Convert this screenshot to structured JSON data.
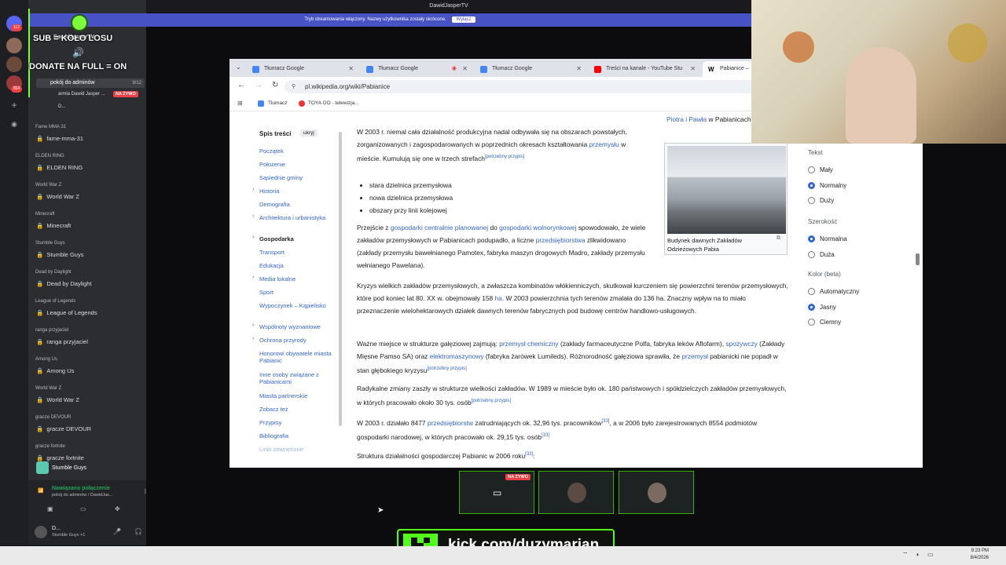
{
  "window": {
    "title": "DawidJasperTV",
    "streaming_notice": "Tryb streamowania włączony. Nazwy użytkownika zostały skrócone.",
    "streaming_off_button": "Wyłącz"
  },
  "overlay": {
    "line1": "SUB = KOŁO LOSU",
    "line2": "DONATE NA FULL = ON",
    "kick_url": "kick.com/duzymarian"
  },
  "discord": {
    "server_name": "DawidJasperTV",
    "badges": [
      "112",
      "864"
    ],
    "live_channel": "pokój do adminów",
    "live_count": "9/12",
    "voice_user1": "armia Dawid Jasper ...",
    "live_badge": "NA ŻYWO",
    "voice_user2": "D...",
    "categories": [
      {
        "cat": "Fame MMA 31",
        "ch": "fame-mma-31"
      },
      {
        "cat": "ELDEN RING",
        "ch": "ELDEN RING"
      },
      {
        "cat": "World War Z",
        "ch": "World War Z"
      },
      {
        "cat": "Minecraft",
        "ch": "Minecraft"
      },
      {
        "cat": "Stumble Guys",
        "ch": "Stumble Guys"
      },
      {
        "cat": "Dead by Daylight",
        "ch": "Dead by Daylight"
      },
      {
        "cat": "League of Legends",
        "ch": "League of Legends"
      },
      {
        "cat": "ranga przyjaciel",
        "ch": "ranga przyjaciel"
      },
      {
        "cat": "Among Us",
        "ch": "Among Us"
      },
      {
        "cat": "World War Z",
        "ch": "World War Z"
      },
      {
        "cat": "gracze DEVOUR",
        "ch": "gracze DEVOUR"
      },
      {
        "cat": "gracze fortnite",
        "ch": "gracze fortnite"
      }
    ],
    "activity": "Stumble Guys",
    "connection_status": "Nawiązano połączenie",
    "connection_channel": "pokój do adminów / DawidJas...",
    "user_name": "D...",
    "user_status": "Stumble Guys +1"
  },
  "browser": {
    "tabs": [
      {
        "label": "Tłumacz Google"
      },
      {
        "label": "Tłumacz Google"
      },
      {
        "label": "Tłumacz Google"
      },
      {
        "label": "Treści na kanale - YouTube Stu"
      },
      {
        "label": "Pabianice –"
      }
    ],
    "url": "pl.wikipedia.org/wiki/Pabianice",
    "bookmarks": [
      "Tłumacz",
      "TOYA GO - telewizja..."
    ]
  },
  "toc": {
    "title": "Spis treści",
    "hide": "ukryj",
    "items": [
      "Początek",
      "Położenie",
      "Sąsiednie gminy",
      "Historia",
      "Demografia",
      "Architektura i urbanistyka",
      "Gospodarka",
      "Transport",
      "Edukacja",
      "Media lokalne",
      "Sport",
      "Wypoczynek – Kąpielisko",
      "Wspólnoty wyznaniowe",
      "Ochrona przyrody",
      "Honorowi obywatele miasta Pabianic",
      "Inne osoby związane z Pabianicami",
      "Miasta partnerskie",
      "Zobacz też",
      "Przypisy",
      "Bibliografia",
      "Linki zewnętrzne"
    ]
  },
  "article": {
    "top_link": "Piotra i Pawła",
    "top_link_after": "w Pabianicach",
    "p1": "W 2003 r. niemal cała działalność produkcyjna nadal odbywała się na obszarach powstałych, zorganizowanych i zagospodarowanych w poprzednich okresach kształtowania",
    "p1_link": "przemysłu",
    "p1_after": "w mieście. Kumulują się one w trzech strefach",
    "cite_needed": "[potrzebny przypis]",
    "bullets": [
      "stara dzielnica przemysłowa",
      "nowa dzielnica przemysłowa",
      "obszary przy linii kolejowej"
    ],
    "p2_a": "Przejście z",
    "p2_l1": "gospodarki centralnie planowanej",
    "p2_b": "do",
    "p2_l2": "gospodarki wolnorynkowej",
    "p2_c": "spowodowało, że wiele zakładów przemysłowych w Pabianicach podupadło, a liczne",
    "p2_l3": "przedsiębiorstwa",
    "p2_d": "zlikwidowano (zakłady przemysłu bawełnianego Pamotex, fabryka maszyn drogowych Madro, zakłady przemysłu wełnianego Pawelana).",
    "p3_a": "Kryzys wielkich zakładów przemysłowych, a zwłaszcza kombinatów włókienniczych, skutkował kurczeniem się powierzchni terenów przemysłowych, które pod koniec lat 80. XX w. obejmowały 158",
    "p3_unit": "ha",
    "p3_b": ". W 2003 powierzchnia tych terenów zmalała do 136 ha. Znaczny wpływ na to miało przeznaczenie wielohektarowych działek dawnych terenów fabrycznych pod budowę centrów handlowo-usługowych.",
    "p4_a": "Ważne miejsce w strukturze gałęziowej zajmują:",
    "p4_l1": "przemysł chemiczny",
    "p4_b": "(zakłady farmaceutyczne Polfa, fabryka leków Aflofarm),",
    "p4_l2": "spożywczy",
    "p4_c": "(Zakłady Mięsne Pamso SA) oraz",
    "p4_l3": "elektromaszynowy",
    "p4_d": "(fabryka żarówek Lumileds). Różnorodność gałęziowa sprawiła, że",
    "p4_l4": "przemysł",
    "p4_e": "pabianicki nie popadł w stan głębokiego kryzysu",
    "p5": "Radykalne zmiany zaszły w strukturze wielkości zakładów. W 1989 w mieście było ok. 180 państwowych i spółdzielczych zakładów przemysłowych, w których pracowało około 30 tys. osób",
    "p6_a": "W 2003 r. działało 8477",
    "p6_l1": "przedsiębiorstw",
    "p6_b": "zatrudniających ok. 32,96 tys. pracowników",
    "ref33": "[33]",
    "p6_c": ", a w 2006 było zarejestrowanych 8554 podmiotów gospodarki narodowej, w których pracowało ok. 29,15 tys. osób",
    "p7": "Struktura działalności gospodarczej Pabianic w 2006 roku",
    "image_caption": "Budynek dawnych Zakładów Odzieżowych Pabia"
  },
  "appearance": {
    "text_title": "Tekst",
    "text_options": [
      "Mały",
      "Normalny",
      "Duży"
    ],
    "width_title": "Szerokość",
    "width_options": [
      "Normalna",
      "Duża"
    ],
    "color_title": "Kolor (beta)",
    "color_options": [
      "Automatyczny",
      "Jasny",
      "Ciemny"
    ]
  },
  "thumbs": {
    "live_badge": "NA ŻYWO"
  },
  "taskbar": {
    "time": "9:23 PM",
    "date": "8/4/2026"
  },
  "colors": {
    "discord_bg": "#2b2d31",
    "kick_green": "#53fc18",
    "link": "#3366cc",
    "overlay_green": "#7cfc3a"
  }
}
